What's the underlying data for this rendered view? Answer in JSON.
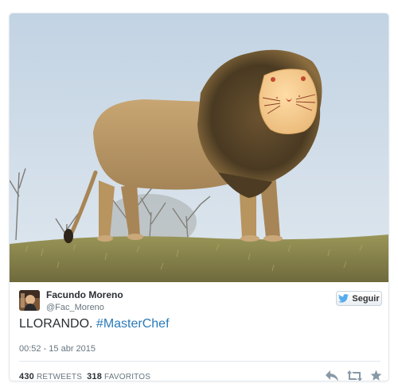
{
  "tweet": {
    "author_name": "Facundo Moreno",
    "author_handle": "@Fac_Moreno",
    "follow_label": "Seguir",
    "text_plain": "LLORANDO.",
    "hashtag": "#MasterChef",
    "timestamp": "00:52 - 15 abr 2015",
    "retweets_count": "430",
    "retweets_label": "RETWEETS",
    "favorites_count": "318",
    "favorites_label": "FAVORITOS"
  },
  "icons": {
    "follow": "twitter-bird-icon",
    "reply": "reply-icon",
    "retweet": "retweet-icon",
    "favorite": "star-icon"
  },
  "colors": {
    "hashtag": "#2b7bb9",
    "text": "#292f33",
    "muted": "#66757f",
    "twitter_blue": "#55acee",
    "sky": "#c9d8e6",
    "grass": "#8a8a52"
  }
}
